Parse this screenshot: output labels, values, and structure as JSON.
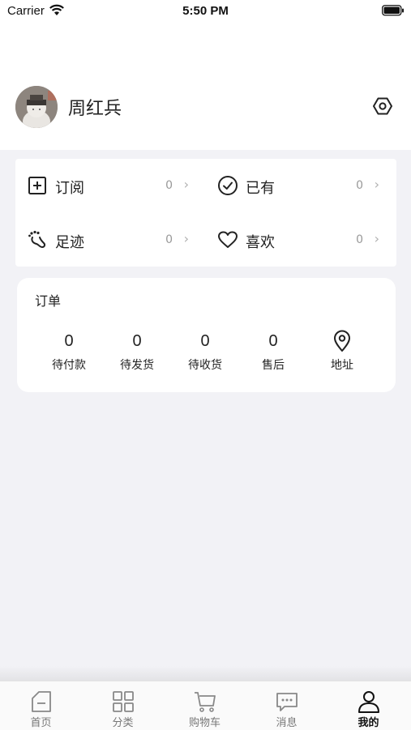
{
  "status_bar": {
    "carrier": "Carrier",
    "time": "5:50 PM"
  },
  "profile": {
    "username": "周红兵",
    "settings_icon": "settings-hexagon-icon"
  },
  "assets": [
    {
      "label": "订阅",
      "count": "0",
      "icon": "plus-square-icon"
    },
    {
      "label": "已有",
      "count": "0",
      "icon": "check-circle-icon"
    },
    {
      "label": "足迹",
      "count": "0",
      "icon": "footprint-icon"
    },
    {
      "label": "喜欢",
      "count": "0",
      "icon": "heart-icon"
    }
  ],
  "orders": {
    "title": "订单",
    "items": [
      {
        "count": "0",
        "label": "待付款"
      },
      {
        "count": "0",
        "label": "待发货"
      },
      {
        "count": "0",
        "label": "待收货"
      },
      {
        "count": "0",
        "label": "售后"
      },
      {
        "label": "地址",
        "icon": "location-pin-icon"
      }
    ]
  },
  "tabbar": {
    "active": "我的",
    "items": [
      {
        "label": "首页",
        "icon": "home-icon"
      },
      {
        "label": "分类",
        "icon": "grid-icon"
      },
      {
        "label": "购物车",
        "icon": "cart-icon"
      },
      {
        "label": "消息",
        "icon": "message-icon"
      },
      {
        "label": "我的",
        "icon": "user-icon"
      }
    ]
  },
  "colors": {
    "background": "#f2f2f6",
    "card": "#ffffff",
    "text": "#222222",
    "muted": "#999999"
  }
}
